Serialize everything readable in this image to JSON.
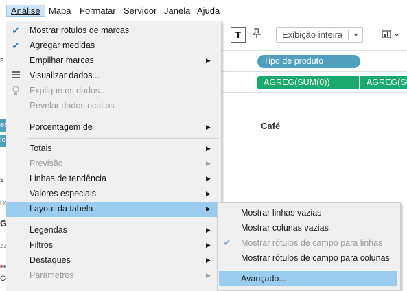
{
  "menubar": {
    "items": [
      "Análise",
      "Mapa",
      "Formatar",
      "Servidor",
      "Janela",
      "Ajuda"
    ]
  },
  "toolbar": {
    "text_button": "T",
    "pin_icon": "pin-icon",
    "fit_select_value": "Exibição inteira",
    "chart_icon": "show-me-icon"
  },
  "shelves": {
    "columns_pill": "Tipo de produto",
    "rows_pills": [
      "AGREG(SUM(0))",
      "AGREG(SU"
    ]
  },
  "view": {
    "column_header": "Café"
  },
  "left_edge": {
    "fragments": [
      "s",
      "es",
      "lo",
      "s",
      "uc",
      "G",
      "zz",
      "Co"
    ]
  },
  "analysis_menu": {
    "items": [
      {
        "label": "Mostrar rótulos de marcas",
        "checked": true
      },
      {
        "label": "Agregar medidas",
        "checked": true
      },
      {
        "label": "Empilhar marcas",
        "submenu": true
      },
      {
        "label": "Visualizar dados...",
        "icon": "grid-icon"
      },
      {
        "label": "Explique os dados...",
        "icon": "lightbulb-icon",
        "disabled": true
      },
      {
        "label": "Revelar dados ocultos",
        "disabled": true
      },
      {
        "label": "Porcentagem de",
        "submenu": true
      },
      {
        "label": "Totais",
        "submenu": true
      },
      {
        "label": "Previsão",
        "submenu": true,
        "disabled": true
      },
      {
        "label": "Linhas de tendência",
        "submenu": true
      },
      {
        "label": "Valores especiais",
        "submenu": true
      },
      {
        "label": "Layout da tabela",
        "submenu": true,
        "highlighted": true
      },
      {
        "label": "Legendas",
        "submenu": true
      },
      {
        "label": "Filtros",
        "submenu": true
      },
      {
        "label": "Destaques",
        "submenu": true
      },
      {
        "label": "Parâmetros",
        "submenu": true,
        "disabled": true
      }
    ]
  },
  "table_layout_submenu": {
    "items": [
      {
        "label": "Mostrar linhas vazias"
      },
      {
        "label": "Mostrar colunas vazias"
      },
      {
        "label": "Mostrar rótulos de campo para linhas",
        "checked": true,
        "disabled": true
      },
      {
        "label": "Mostrar rótulos de campo para colunas"
      },
      {
        "label": "Avançado...",
        "highlighted": true
      }
    ]
  },
  "colors": {
    "menu_bg": "#f0f0f0",
    "highlight": "#99ccee",
    "dimension_pill": "#4f9fbf",
    "measure_pill": "#1baa6e",
    "check": "#2b78c5"
  }
}
